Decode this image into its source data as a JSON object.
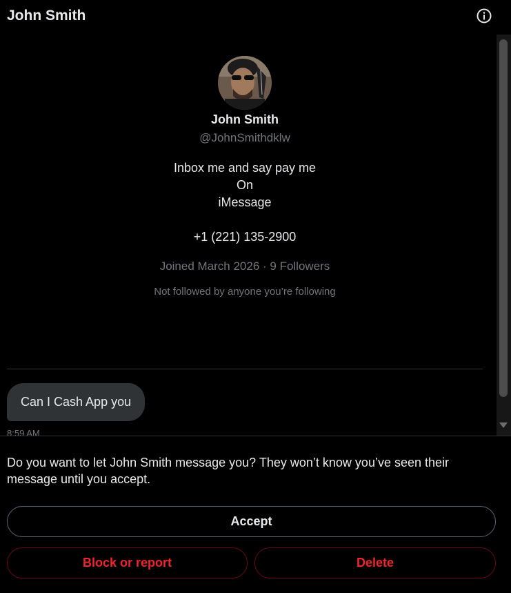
{
  "header": {
    "title": "John Smith",
    "info_icon": "info-circle-icon"
  },
  "profile": {
    "name": "John Smith",
    "handle": "@JohnSmithdklw",
    "bio_lines": [
      "Inbox me and say pay me",
      "On",
      "iMessage"
    ],
    "phone": "+1 (221) 135-2900",
    "joined": "Joined March 2026 · 9 Followers",
    "followed_by": "Not followed by anyone you’re following"
  },
  "messages": [
    {
      "text": "Can I Cash App you",
      "time": "8:59 AM"
    }
  ],
  "request": {
    "prompt": "Do you want to let John Smith message you? They won’t know you’ve seen their message until you accept.",
    "accept_label": "Accept",
    "block_label": "Block or report",
    "delete_label": "Delete"
  },
  "colors": {
    "background": "#000000",
    "text_primary": "#e7e9ea",
    "text_secondary": "#71767b",
    "bubble": "#2f3336",
    "danger": "#f4212e"
  }
}
